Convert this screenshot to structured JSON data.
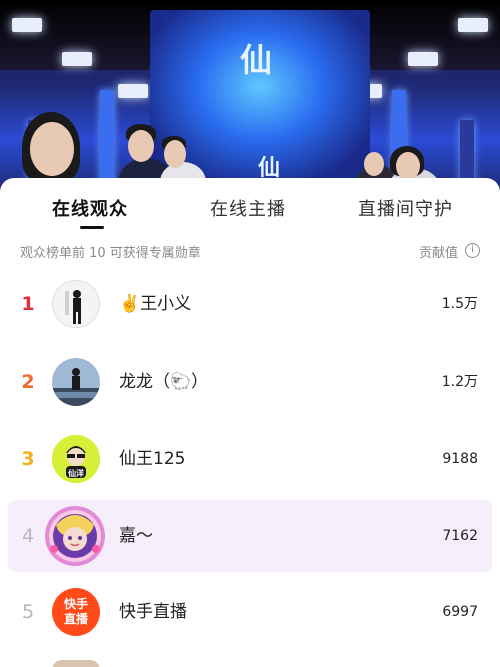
{
  "stream": {
    "screen_char": "仙",
    "screen_char_secondary": "仙"
  },
  "tabs": [
    {
      "label": "在线观众",
      "active": true
    },
    {
      "label": "在线主播",
      "active": false
    },
    {
      "label": "直播间守护",
      "active": false
    }
  ],
  "subheader": {
    "hint": "观众榜单前 10 可获得专属勋章",
    "metric_label": "贡献值",
    "info_icon": "info-icon"
  },
  "colors": {
    "rank1": "#e02e3c",
    "rank2": "#ef6a2a",
    "rank3": "#f2b21c",
    "rank_other": "#b8b8b8",
    "highlight_row": "#f6effb"
  },
  "rows": [
    {
      "rank": "1",
      "name": "✌️王小义",
      "score": "1.5万",
      "highlight": false
    },
    {
      "rank": "2",
      "name": "龙龙（🐑）",
      "score": "1.2万",
      "highlight": false
    },
    {
      "rank": "3",
      "name": "仙王125",
      "score": "9188",
      "highlight": false
    },
    {
      "rank": "4",
      "name": "嘉～",
      "score": "7162",
      "highlight": true
    },
    {
      "rank": "5",
      "name": "快手直播",
      "score": "6997",
      "highlight": false
    }
  ],
  "avatars": {
    "row3_caption": "仙洋",
    "row5_line1": "快手",
    "row5_line2": "直播"
  }
}
